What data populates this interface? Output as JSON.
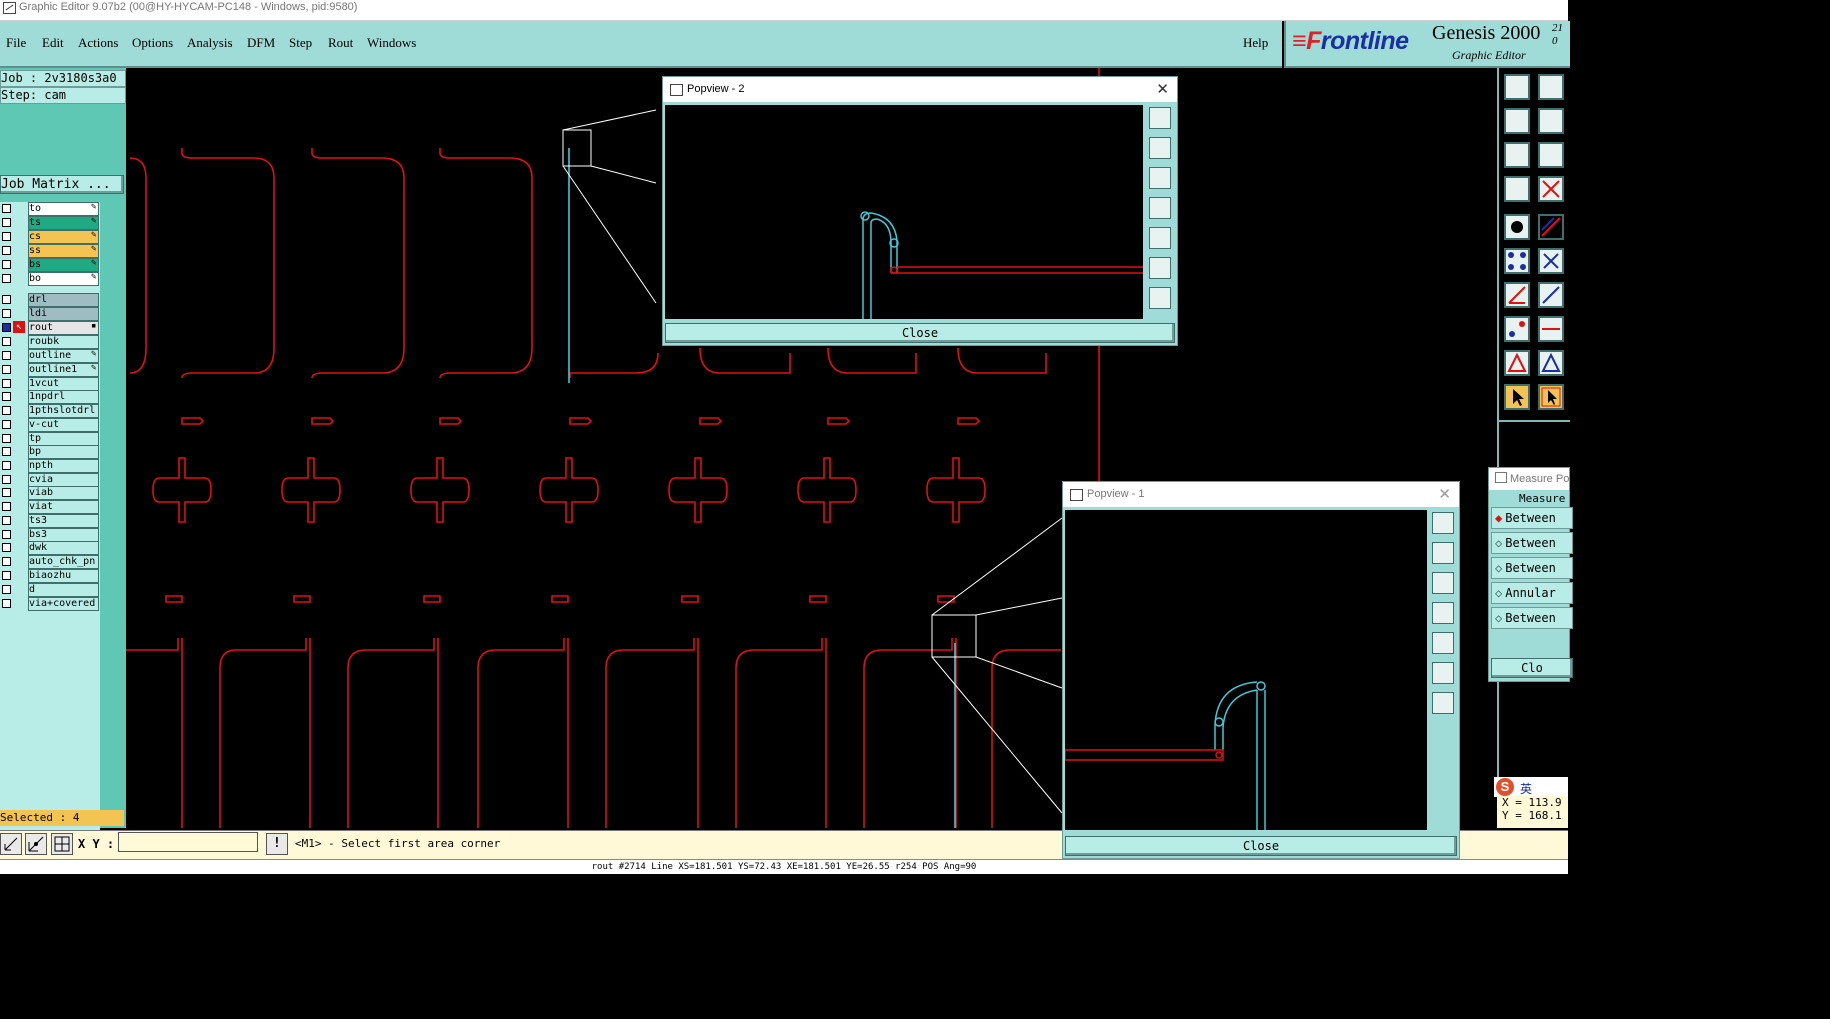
{
  "window_title": "Graphic Editor 9.07b2 (00@HY-HYCAM-PC148 - Windows, pid:9580)",
  "menu": {
    "items": [
      "File",
      "Edit",
      "Actions",
      "Options",
      "Analysis",
      "DFM",
      "Step",
      "Rout",
      "Windows"
    ],
    "help": "Help"
  },
  "brand": {
    "logo_pre": "F",
    "logo_rest": "rontline",
    "product": "Genesis 2000",
    "sup": "21",
    "sup2": "0",
    "subtitle": "Graphic Editor"
  },
  "left": {
    "job": "Job : 2v3180s3a0",
    "step": "Step: cam",
    "job_matrix": "Job Matrix ...",
    "layers": [
      {
        "name": "to",
        "color": "#ffffff",
        "edit": true
      },
      {
        "name": "ts",
        "color": "#1faa83",
        "edit": true
      },
      {
        "name": "cs",
        "color": "#f4c453",
        "edit": true
      },
      {
        "name": "ss",
        "color": "#f4c453",
        "edit": true
      },
      {
        "name": "bs",
        "color": "#1faa83",
        "edit": true
      },
      {
        "name": "bo",
        "color": "#ffffff",
        "edit": true
      },
      {
        "name": "drl",
        "color": "#9fbcc2",
        "edit": false
      },
      {
        "name": "ldi",
        "color": "#9fbcc2",
        "edit": false
      },
      {
        "name": "rout",
        "color": "#e5e5e5",
        "edit": false,
        "active": true
      },
      {
        "name": "roubk",
        "color": "#b8ece6",
        "edit": false
      },
      {
        "name": "outline",
        "color": "#b8ece6",
        "edit": true
      },
      {
        "name": "outline1",
        "color": "#b8ece6",
        "edit": true
      },
      {
        "name": "1vcut",
        "color": "#b8ece6",
        "edit": false
      },
      {
        "name": "1npdrl",
        "color": "#b8ece6",
        "edit": false
      },
      {
        "name": "1pthslotdrl",
        "color": "#b8ece6",
        "edit": false
      },
      {
        "name": "v-cut",
        "color": "#b8ece6",
        "edit": false
      },
      {
        "name": "tp",
        "color": "#b8ece6",
        "edit": false
      },
      {
        "name": "bp",
        "color": "#b8ece6",
        "edit": false
      },
      {
        "name": "npth",
        "color": "#b8ece6",
        "edit": false
      },
      {
        "name": "cvia",
        "color": "#b8ece6",
        "edit": false
      },
      {
        "name": "viab",
        "color": "#b8ece6",
        "edit": false
      },
      {
        "name": "viat",
        "color": "#b8ece6",
        "edit": false
      },
      {
        "name": "ts3",
        "color": "#b8ece6",
        "edit": false
      },
      {
        "name": "bs3",
        "color": "#b8ece6",
        "edit": false
      },
      {
        "name": "dwk",
        "color": "#b8ece6",
        "edit": false
      },
      {
        "name": "auto_chk_pn",
        "color": "#b8ece6",
        "edit": false
      },
      {
        "name": "biaozhu",
        "color": "#b8ece6",
        "edit": false
      },
      {
        "name": "d",
        "color": "#b8ece6",
        "edit": false
      },
      {
        "name": "via+covered",
        "color": "#b8ece6",
        "edit": false
      }
    ],
    "selected": "Selected : 4"
  },
  "cmd": {
    "xy_label": "X Y :",
    "xy_value": "",
    "prompt": "<M1> - Select first area corner"
  },
  "status": "rout #2714 Line XS=181.501 YS=72.43 XE=181.501 YE=26.55 r254 POS Ang=90",
  "popview2": {
    "title": "Popview - 2",
    "close": "Close"
  },
  "popview1": {
    "title": "Popview - 1",
    "close": "Close"
  },
  "measure": {
    "title": "Measure Po",
    "header": "Measure",
    "options": [
      "Between",
      "Between",
      "Between",
      "Annular",
      "Between"
    ],
    "close": "Clo"
  },
  "coords": {
    "x": "X = 113.9",
    "y": "Y = 168.1"
  },
  "ime": {
    "lang": "英"
  },
  "colors": {
    "teal": "#9fdcd8",
    "panel": "#5fc8b5",
    "graphics_red": "#e01010",
    "graphics_cyan": "#41c8d6"
  }
}
